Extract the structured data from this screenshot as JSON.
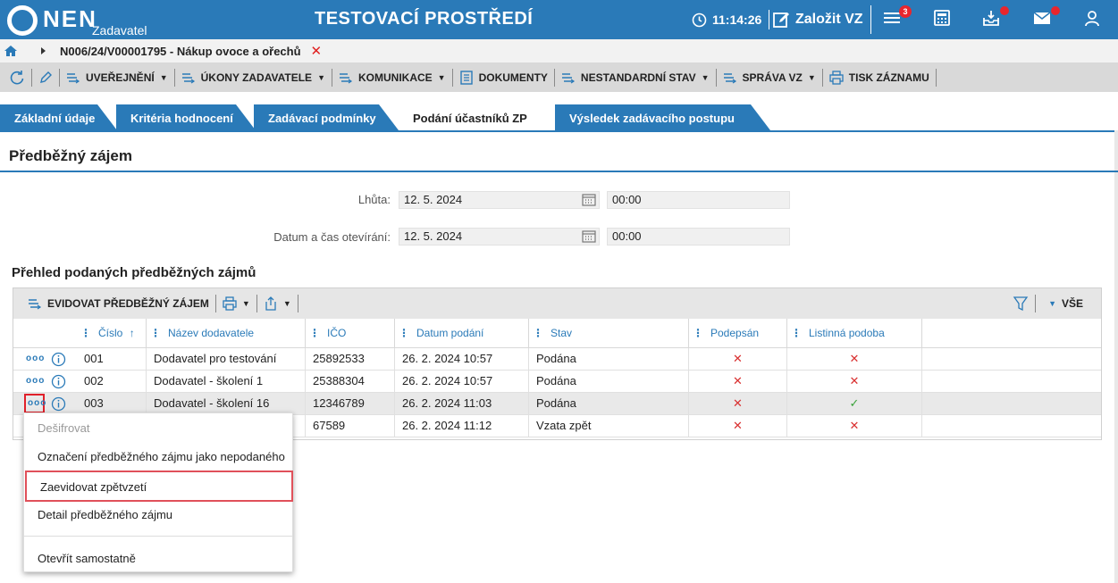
{
  "header": {
    "logo_text": "NEN",
    "logo_sub": "Zadavatel",
    "title": "TESTOVACÍ PROSTŘEDÍ",
    "time": "11:14:26",
    "create_label": "Založit VZ",
    "notifications_count": "3"
  },
  "breadcrumb": {
    "path": "N006/24/V00001795 - Nákup ovoce a ořechů"
  },
  "toolbar": {
    "items": [
      "UVEŘEJNĚNÍ",
      "ÚKONY ZADAVATELE",
      "KOMUNIKACE",
      "DOKUMENTY",
      "NESTANDARDNÍ STAV",
      "SPRÁVA VZ",
      "TISK ZÁZNAMU"
    ]
  },
  "tabs": [
    "Základní údaje",
    "Kritéria hodnocení",
    "Zadávací podmínky",
    "Podání účastníků ZP",
    "Výsledek zadávacího postupu"
  ],
  "active_tab": "Podání účastníků ZP",
  "section": {
    "title": "Předběžný zájem"
  },
  "form": {
    "deadline_label": "Lhůta:",
    "deadline_date": "12. 5. 2024",
    "deadline_time": "00:00",
    "opening_label": "Datum a čas otevírání:",
    "opening_date": "12. 5. 2024",
    "opening_time": "00:00"
  },
  "grid": {
    "title": "Přehled podaných předběžných zájmů",
    "toolbar_register": "EVIDOVAT PŘEDBĚŽNÝ ZÁJEM",
    "toolbar_all": "VŠE",
    "columns": [
      "Číslo",
      "Název dodavatele",
      "IČO",
      "Datum podání",
      "Stav",
      "Podepsán",
      "Listinná podoba"
    ],
    "rows": [
      {
        "cislo": "001",
        "nazev": "Dodavatel pro testování",
        "ico": "25892533",
        "datum": "26. 2. 2024 10:57",
        "stav": "Podána",
        "podepsan": "no",
        "listinna": "no"
      },
      {
        "cislo": "002",
        "nazev": "Dodavatel - školení 1",
        "ico": "25388304",
        "datum": "26. 2. 2024 10:57",
        "stav": "Podána",
        "podepsan": "no",
        "listinna": "no"
      },
      {
        "cislo": "003",
        "nazev": "Dodavatel - školení 16",
        "ico": "12346789",
        "datum": "26. 2. 2024 11:03",
        "stav": "Podána",
        "podepsan": "no",
        "listinna": "yes"
      },
      {
        "cislo": "",
        "nazev": "",
        "ico": "67589",
        "datum": "26. 2. 2024 11:12",
        "stav": "Vzata zpět",
        "podepsan": "no",
        "listinna": "no"
      }
    ]
  },
  "context_menu": {
    "items": [
      "Dešifrovat",
      "Označení předběžného zájmu jako nepodaného",
      "Zaevidovat zpětvzetí",
      "Detail předběžného zájmu",
      "Otevřít samostatně"
    ]
  },
  "colors": {
    "brand": "#2a7ab8",
    "alert": "#e8262d",
    "cross": "#d93030",
    "check": "#3aa23a"
  }
}
